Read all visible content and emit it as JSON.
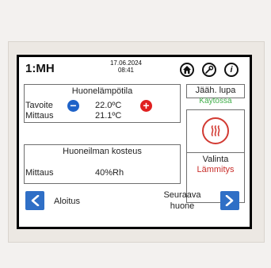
{
  "header": {
    "room_id": "1:MH",
    "date": "17.06.2024",
    "time": "08:41",
    "icons": [
      "home-icon",
      "wrench-icon",
      "info-icon"
    ],
    "info_glyph": "i"
  },
  "room_temperature": {
    "title": "Huonelämpötila",
    "target_label": "Tavoite",
    "target_value": "22.0ºC",
    "measurement_label": "Mittaus",
    "measurement_value": "21.1ºC"
  },
  "cooling_permission": {
    "title": "Jääh. lupa",
    "status": "Käytössä"
  },
  "humidity": {
    "title": "Huoneilman kosteus",
    "measurement_label": "Mittaus",
    "measurement_value": "40%Rh"
  },
  "mode": {
    "title": "Valinta",
    "value": "Lämmitys",
    "icon": "heating-icon"
  },
  "navigation": {
    "back_label": "Aloitus",
    "next_line1": "Seuraava",
    "next_line2": "huone"
  },
  "colors": {
    "blue_button": "#2f6fc6",
    "minus_button": "#1f63c8",
    "plus_button": "#e02020",
    "status_green": "#3fae49",
    "mode_red": "#c9302c"
  }
}
